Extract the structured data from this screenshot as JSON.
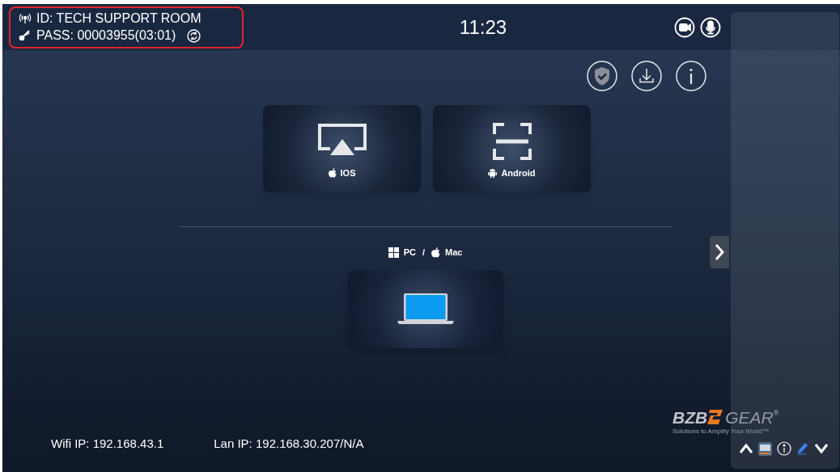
{
  "header": {
    "room_id": "ID: TECH SUPPORT ROOM",
    "password": "PASS: 00003955(03:01)",
    "time": "11:23"
  },
  "cast_options": [
    {
      "kind": "airplay",
      "label": "IOS"
    },
    {
      "kind": "android",
      "label": "Android"
    }
  ],
  "pc_section": {
    "pc_label": "PC",
    "separator": "/",
    "mac_label": "Mac"
  },
  "footer": {
    "wifi_ip": "Wifi IP: 192.168.43.1",
    "lan_ip": "Lan IP: 192.168.30.207/N/A"
  },
  "logo": {
    "brand_left": "BZB",
    "brand_right": "GEAR",
    "registered": "®",
    "tagline": "Solutions to Amplify Your World™"
  }
}
